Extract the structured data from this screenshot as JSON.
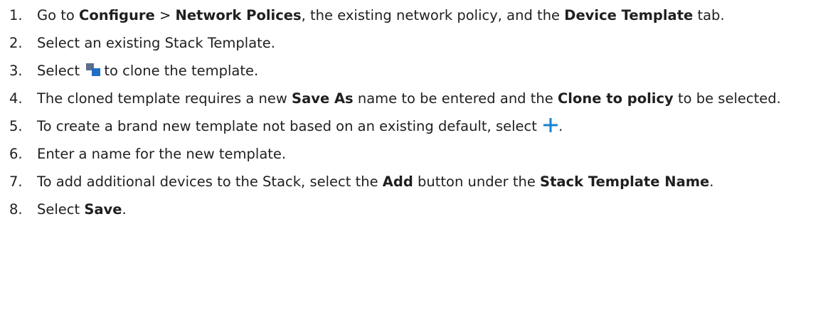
{
  "steps": [
    {
      "number": "1.",
      "t1": "Go to ",
      "b1": "Configure",
      "t2": " > ",
      "b2": "Network Polices",
      "t3": ", the existing network policy, and the ",
      "b3": "Device Template",
      "t4": " tab."
    },
    {
      "number": "2.",
      "t1": "Select an existing Stack Template."
    },
    {
      "number": "3.",
      "t1": "Select",
      "icon": "clone-icon",
      "t2": "to clone the template."
    },
    {
      "number": "4.",
      "t1": "The cloned template requires a new ",
      "b1": "Save As",
      "t2": " name to be entered and the ",
      "b2": "Clone to policy",
      "t3": " to be selected."
    },
    {
      "number": "5.",
      "t1": "To create a brand new template not based on an existing default, select ",
      "icon": "plus-icon",
      "t2": "."
    },
    {
      "number": "6.",
      "t1": "Enter a name for the new template."
    },
    {
      "number": "7.",
      "t1": "To add additional devices to the Stack, select the ",
      "b1": "Add",
      "t2": " button under the ",
      "b2": "Stack Template Name",
      "t3": "."
    },
    {
      "number": "8.",
      "t1": "Select ",
      "b1": "Save",
      "t2": "."
    }
  ],
  "colors": {
    "text": "#1f1f1f",
    "clone_icon_back": "#5a6f8c",
    "clone_icon_front": "#1f6fc4",
    "plus_icon": "#1a82d2"
  }
}
